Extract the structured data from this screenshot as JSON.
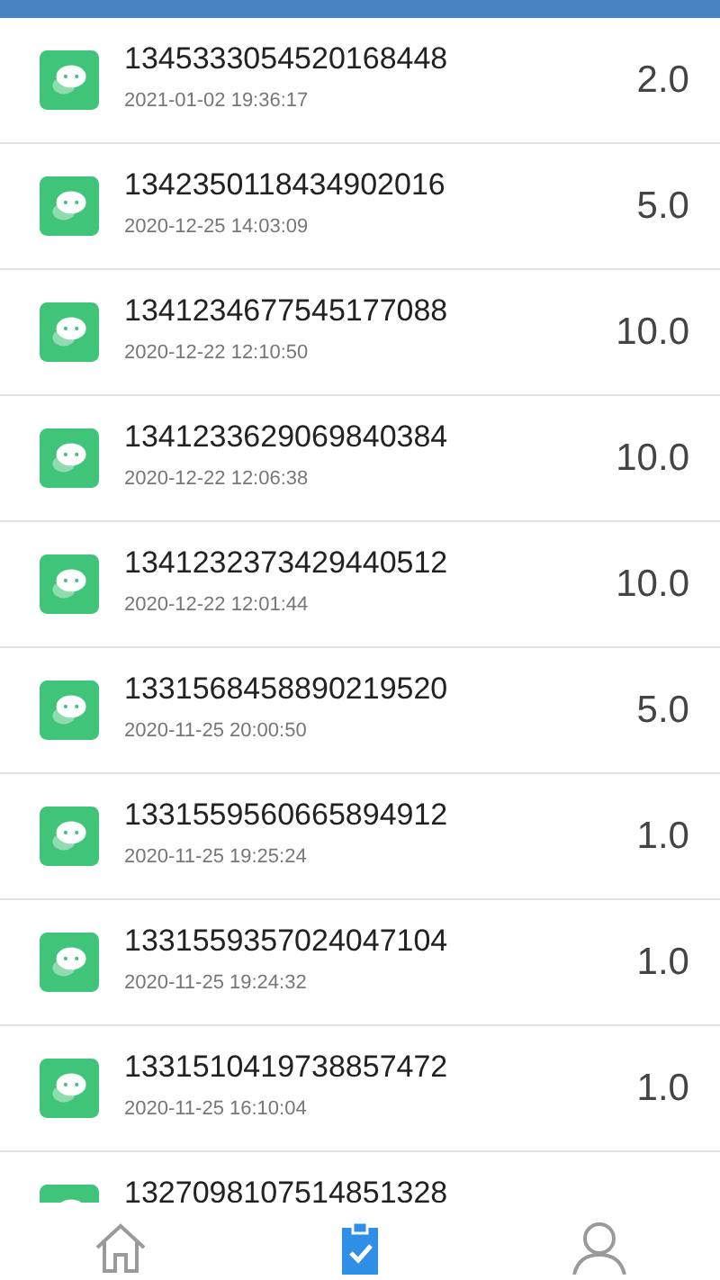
{
  "records": [
    {
      "id": "1345333054520168448",
      "time": "2021-01-02 19:36:17",
      "amount": "2.0"
    },
    {
      "id": "1342350118434902016",
      "time": "2020-12-25 14:03:09",
      "amount": "5.0"
    },
    {
      "id": "1341234677545177088",
      "time": "2020-12-22 12:10:50",
      "amount": "10.0"
    },
    {
      "id": "1341233629069840384",
      "time": "2020-12-22 12:06:38",
      "amount": "10.0"
    },
    {
      "id": "1341232373429440512",
      "time": "2020-12-22 12:01:44",
      "amount": "10.0"
    },
    {
      "id": "1331568458890219520",
      "time": "2020-11-25 20:00:50",
      "amount": "5.0"
    },
    {
      "id": "1331559560665894912",
      "time": "2020-11-25 19:25:24",
      "amount": "1.0"
    },
    {
      "id": "1331559357024047104",
      "time": "2020-11-25 19:24:32",
      "amount": "1.0"
    },
    {
      "id": "1331510419738857472",
      "time": "2020-11-25 16:10:04",
      "amount": "1.0"
    },
    {
      "id": "1327098107514851328"
    }
  ],
  "nav": [
    {
      "kind": "home",
      "selected": false
    },
    {
      "kind": "orders",
      "selected": true
    },
    {
      "kind": "profile",
      "selected": false
    }
  ]
}
